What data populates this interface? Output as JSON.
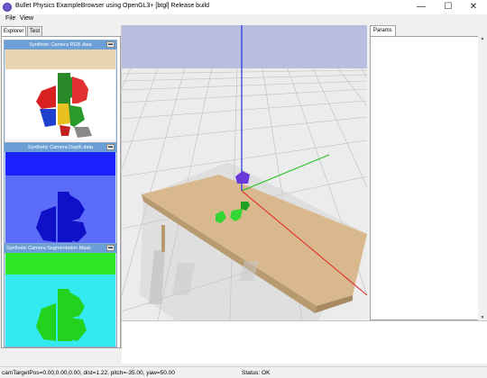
{
  "window": {
    "title": "Bullet Physics ExampleBrowser using OpenGL3+ [btgl] Release build",
    "minimize_glyph": "—",
    "maximize_glyph": "☐",
    "close_glyph": "✕"
  },
  "menu": {
    "items": [
      "File",
      "View"
    ]
  },
  "left_panel": {
    "tabs": [
      "Explorer",
      "Test"
    ],
    "cameras": [
      {
        "title": "Synthetic Camera RGB data",
        "close_glyph": "▬"
      },
      {
        "title": "Synthetic Camera Depth data",
        "close_glyph": "▬"
      },
      {
        "title": "Synthetic Camera Segmentation Mask",
        "close_glyph": "▬"
      }
    ]
  },
  "params_panel": {
    "tab": "Params"
  },
  "status": {
    "camera": "camTargetPos=0.00,0.00,0.00, dist=1.22, pitch=-35.00, yaw=50.00",
    "state": "Status: OK"
  },
  "colors": {
    "sky": "#b8bee0",
    "floor": "#e8e8e8",
    "table": "#d8b88c",
    "axis_x": "#e02020",
    "axis_y": "#20c020",
    "axis_z": "#2030e0",
    "depth_bg": "#3a48f0",
    "seg_bg": "#33eaf0",
    "seg_top": "#2ee828"
  }
}
